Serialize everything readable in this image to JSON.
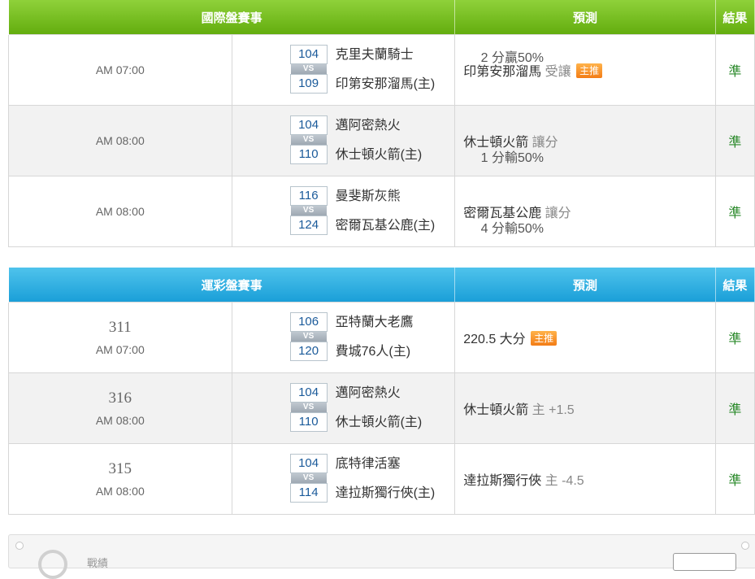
{
  "intl": {
    "header": {
      "game": "國際盤賽事",
      "prediction": "預測",
      "result": "結果"
    },
    "rows": [
      {
        "time": "AM 07:00",
        "score1": "104",
        "score2": "109",
        "vs": "VS",
        "team1": "克里夫蘭騎士",
        "team2": "印第安那溜馬(主)",
        "odds": "2 分贏50%",
        "odds_on": 1,
        "pred_team": "印第安那溜馬",
        "pred_type": "受讓",
        "badge": "主推",
        "result": "準"
      },
      {
        "time": "AM 08:00",
        "score1": "104",
        "score2": "110",
        "vs": "VS",
        "team1": "邁阿密熱火",
        "team2": "休士頓火箭(主)",
        "odds": "1 分輸50%",
        "odds_on": 2,
        "pred_team": "休士頓火箭",
        "pred_type": "讓分",
        "badge": "",
        "result": "準"
      },
      {
        "time": "AM 08:00",
        "score1": "116",
        "score2": "124",
        "vs": "VS",
        "team1": "曼斐斯灰熊",
        "team2": "密爾瓦基公鹿(主)",
        "odds": "4 分輸50%",
        "odds_on": 2,
        "pred_team": "密爾瓦基公鹿",
        "pred_type": "讓分",
        "badge": "",
        "result": "準"
      }
    ]
  },
  "sport": {
    "header": {
      "game": "運彩盤賽事",
      "prediction": "預測",
      "result": "結果"
    },
    "rows": [
      {
        "no": "311",
        "time": "AM 07:00",
        "score1": "106",
        "score2": "120",
        "vs": "VS",
        "team1": "亞特蘭大老鷹",
        "team2": "費城76人(主)",
        "pred_team": "220.5 大分",
        "pred_type": "",
        "badge": "主推",
        "result": "準"
      },
      {
        "no": "316",
        "time": "AM 08:00",
        "score1": "104",
        "score2": "110",
        "vs": "VS",
        "team1": "邁阿密熱火",
        "team2": "休士頓火箭(主)",
        "pred_team": "休士頓火箭",
        "pred_type": "主 +1.5",
        "badge": "",
        "result": "準"
      },
      {
        "no": "315",
        "time": "AM 08:00",
        "score1": "104",
        "score2": "114",
        "vs": "VS",
        "team1": "底特律活塞",
        "team2": "達拉斯獨行俠(主)",
        "pred_team": "達拉斯獨行俠",
        "pred_type": "主 -4.5",
        "badge": "",
        "result": "準"
      }
    ]
  },
  "bottom": {
    "text": "戰績"
  }
}
